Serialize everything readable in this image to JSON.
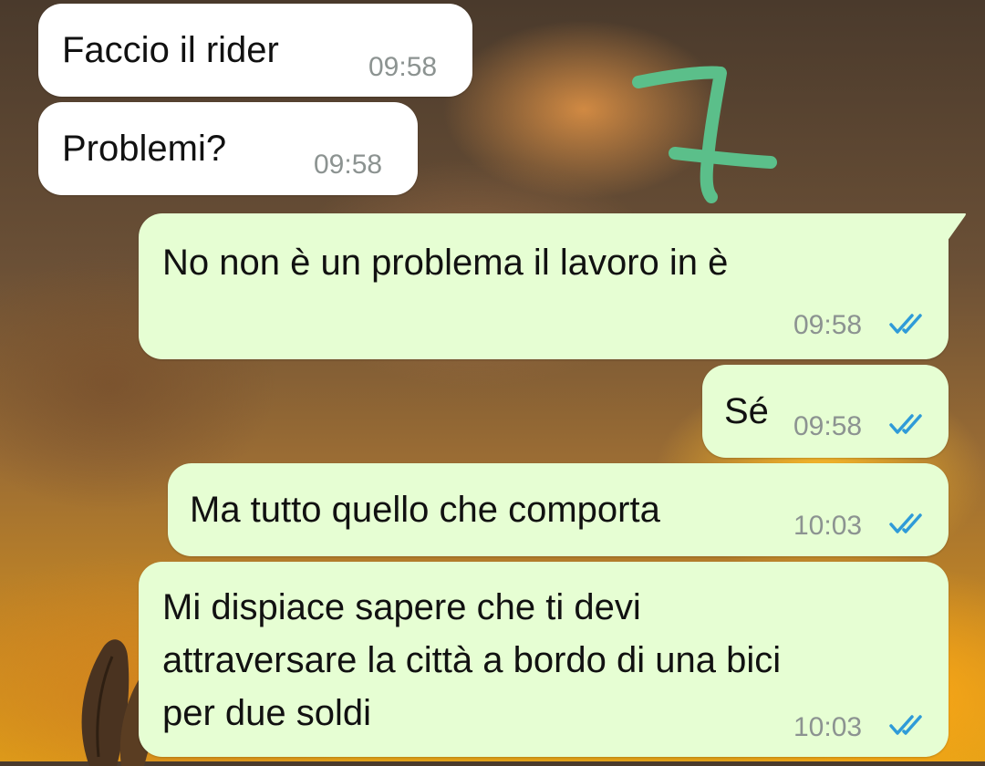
{
  "colors": {
    "incoming_bubble": "#ffffff",
    "outgoing_bubble": "#e6fed3",
    "timestamp": "#8c9391",
    "read_ticks": "#2f9bd8",
    "annotation": "#5bbf8a"
  },
  "annotation": {
    "text": "7"
  },
  "messages": [
    {
      "direction": "incoming",
      "text": "Faccio il rider",
      "time": "09:58"
    },
    {
      "direction": "incoming",
      "text": "Problemi?",
      "time": "09:58"
    },
    {
      "direction": "outgoing",
      "text": "No non è un problema il lavoro in è",
      "time": "09:58",
      "status_icon": "double-check-read-icon"
    },
    {
      "direction": "outgoing",
      "text": "Sé",
      "time": "09:58",
      "status_icon": "double-check-read-icon"
    },
    {
      "direction": "outgoing",
      "text": "Ma tutto quello che comporta",
      "time": "10:03",
      "status_icon": "double-check-read-icon"
    },
    {
      "direction": "outgoing",
      "lines": [
        "Mi dispiace sapere che ti devi",
        "attraversare la città a bordo di una bici",
        "per due soldi"
      ],
      "time": "10:03",
      "status_icon": "double-check-read-icon"
    }
  ]
}
